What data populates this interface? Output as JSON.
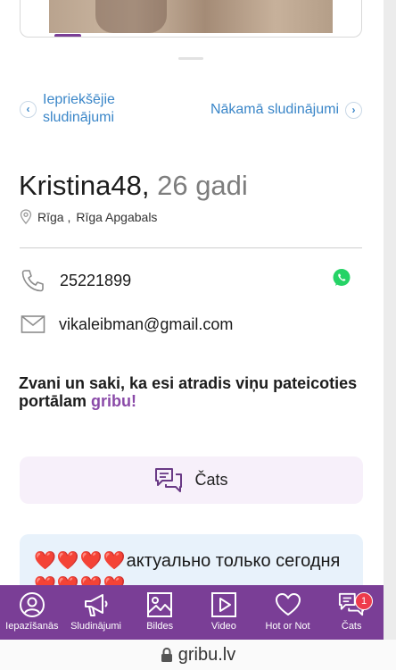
{
  "nav": {
    "prev_label": "Iepriekšējie sludinājumi",
    "next_label": "Nākamā sludinājumi"
  },
  "profile": {
    "name": "Kristina48,",
    "age": "26 gadi",
    "city": "Rīga ,",
    "region": "Rīga Apgabals"
  },
  "contacts": {
    "phone": "25221899",
    "email": "vikaleibman@gmail.com"
  },
  "promo": {
    "text": "Zvani un saki, ka esi atradis viņu pateicoties portālam ",
    "brand": "gribu!"
  },
  "chat_button": {
    "label": "Čats"
  },
  "message": {
    "hearts_start": "❤️❤️❤️❤️",
    "text": "актуально только сегодня",
    "hearts_end": "❤️❤️❤️❤️"
  },
  "tabbar": {
    "items": [
      {
        "label": "Iepazīšanās",
        "icon": "user-icon"
      },
      {
        "label": "Sludinājumi",
        "icon": "megaphone-icon"
      },
      {
        "label": "Bildes",
        "icon": "image-icon"
      },
      {
        "label": "Video",
        "icon": "video-icon"
      },
      {
        "label": "Hot or Not",
        "icon": "heart-icon"
      },
      {
        "label": "Čats",
        "icon": "chat-icon"
      }
    ],
    "chat_badge": "1"
  },
  "browser": {
    "url": "gribu.lv"
  },
  "colors": {
    "brand_purple": "#7a3e96",
    "link_blue": "#3a86c8",
    "whatsapp_green": "#25d366",
    "badge_red": "#ee3b4b"
  }
}
